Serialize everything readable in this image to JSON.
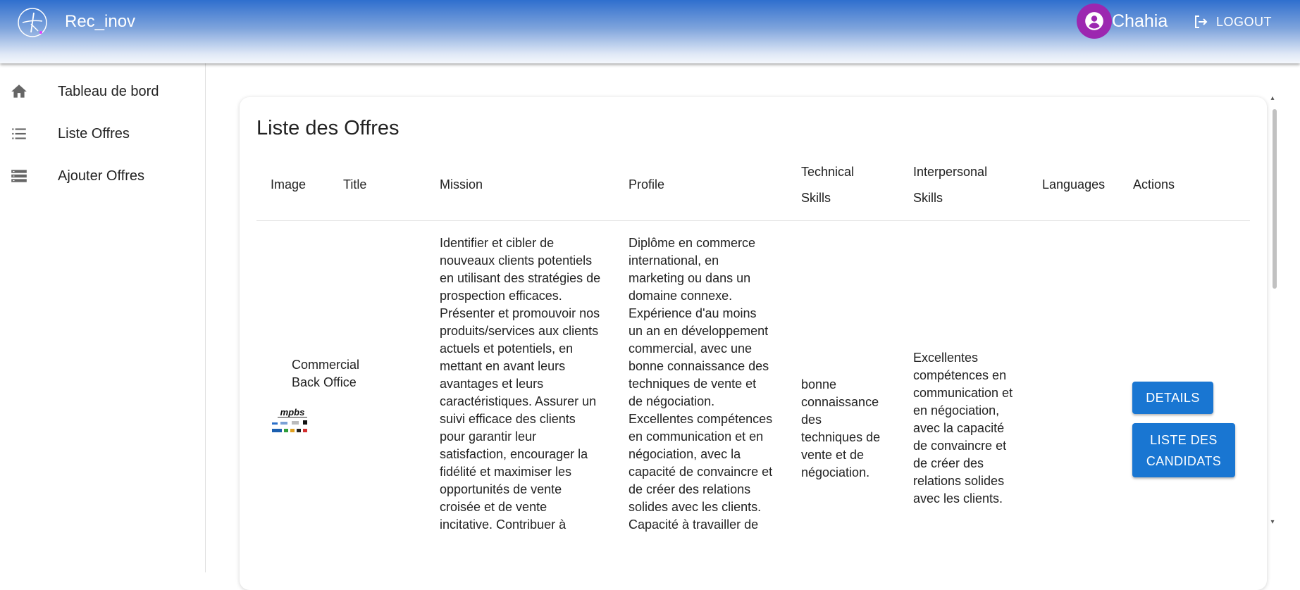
{
  "header": {
    "app_title": "Rec_inov",
    "user_name": "Chahia",
    "logout_label": "LOGOUT"
  },
  "sidebar": {
    "items": [
      {
        "label": "Tableau de bord",
        "icon": "home-icon"
      },
      {
        "label": "Liste Offres",
        "icon": "list-icon"
      },
      {
        "label": "Ajouter Offres",
        "icon": "storage-icon"
      }
    ]
  },
  "main": {
    "card_title": "Liste des Offres",
    "columns": [
      "Image",
      "Title",
      "Mission",
      "Profile",
      "Technical",
      "Skills",
      "Interpersonal",
      "Skills",
      "Languages",
      "Actions"
    ],
    "row": {
      "image_logo_text": "mpbs",
      "title_lines": [
        "Commercial",
        "Back Office"
      ],
      "mission_lines": [
        "Identifier et cibler de",
        "nouveaux clients potentiels",
        "en utilisant des stratégies de",
        "prospection efficaces.",
        "Présenter et promouvoir nos",
        "produits/services aux clients",
        "actuels et potentiels, en",
        "mettant en avant leurs",
        "avantages et leurs",
        "caractéristiques. Assurer un",
        "suivi efficace des clients",
        "pour garantir leur",
        "satisfaction, encourager la",
        "fidélité et maximiser les",
        "opportunités de vente",
        "croisée et de vente",
        "incitative. Contribuer à"
      ],
      "profile_lines": [
        "Diplôme en commerce",
        "international, en",
        "marketing ou dans un",
        "domaine connexe.",
        "Expérience d'au moins",
        "un an en développement",
        "commercial, avec une",
        "bonne connaissance des",
        "techniques de vente et",
        "de négociation.",
        "Excellentes compétences",
        "en communication et en",
        "négociation, avec la",
        "capacité de convaincre et",
        "de créer des relations",
        "solides avec les clients.",
        "Capacité à travailler de"
      ],
      "technical_lines": [
        "bonne",
        "connaissance",
        "des",
        "techniques de",
        "vente et de",
        "négociation."
      ],
      "interpersonal_lines": [
        "Excellentes",
        "compétences en",
        "communication et",
        "en négociation,",
        "avec la capacité",
        "de convaincre et",
        "de créer des",
        "relations solides",
        "avec les clients."
      ],
      "languages": "",
      "actions": {
        "details_label": "DETAILS",
        "candidates_label_1": "LISTE DES",
        "candidates_label_2": "CANDIDATS"
      }
    }
  },
  "colors": {
    "header_top": "#2f6fce",
    "avatar": "#9c27b0",
    "button": "#1976d2"
  }
}
